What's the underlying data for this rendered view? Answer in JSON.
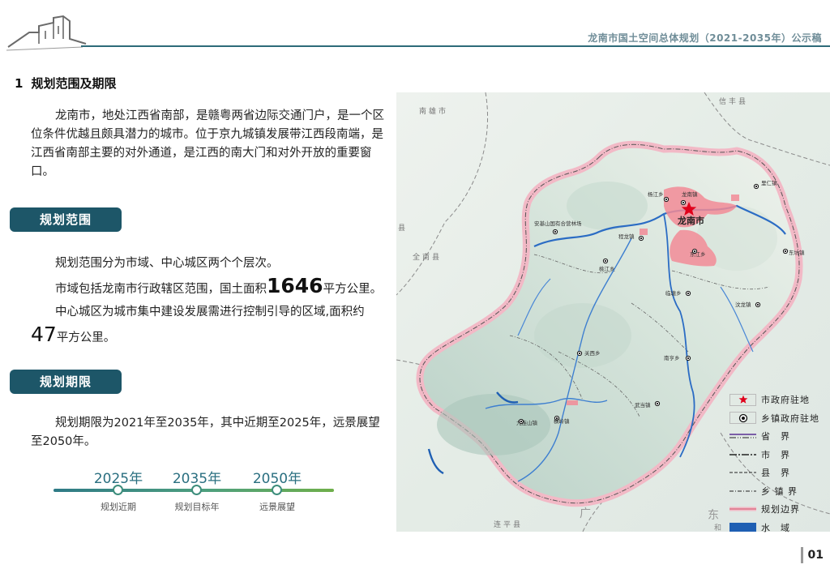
{
  "header": {
    "title": "龙南市国土空间总体规划（2021-2035年）公示稿"
  },
  "section": {
    "number": "1",
    "title": "规划范围及期限"
  },
  "intro": {
    "text": "龙南市，地处江西省南部，是赣粤两省边际交通门户，是一个区位条件优越且颇具潜力的城市。位于京九城镇发展带江西段南端，是江西省南部主要的对外通道，是江西的南大门和对外开放的重要窗口。"
  },
  "scope": {
    "heading": "规划范围",
    "line1": "规划范围分为市域、中心城区两个个层次。",
    "line2_prefix": "市域包括龙南市行政辖区范围，国土面积",
    "area_total": "1646",
    "line2_suffix": "平方公里。",
    "line3": "中心城区为城市集中建设发展需进行控制引导的区域,面积约",
    "area_center": "47",
    "line4_suffix": "平方公里。"
  },
  "period": {
    "heading": "规划期限",
    "text": "规划期限为2021年至2035年，其中近期至2025年，远景展望至2050年。"
  },
  "timeline": [
    {
      "year": "2025年",
      "label": "规划近期"
    },
    {
      "year": "2035年",
      "label": "规划目标年"
    },
    {
      "year": "2050年",
      "label": "远景展望"
    }
  ],
  "map": {
    "city_label": "龙南市",
    "outer_labels": [
      "南雄市",
      "信丰县",
      "全南县",
      "县",
      "连平县",
      "广",
      "东",
      "和"
    ],
    "towns": [
      "杨江乡",
      "龙南镇",
      "东江乡",
      "里仁镇",
      "安基山国有合营林场",
      "程龙镇",
      "东坑镇",
      "桃江乡",
      "临塘乡",
      "汶龙镇",
      "关西乡",
      "南亨乡",
      "九连山镇",
      "横岭镇",
      "武当镇"
    ]
  },
  "legend": [
    {
      "icon": "red-star",
      "label": "市政府驻地"
    },
    {
      "icon": "town-dot",
      "label": "乡镇政府驻地"
    },
    {
      "icon": "province-boundary",
      "label": "省　界"
    },
    {
      "icon": "city-boundary",
      "label": "市　界"
    },
    {
      "icon": "county-boundary",
      "label": "县　界"
    },
    {
      "icon": "township-boundary",
      "label": "乡 镇 界"
    },
    {
      "icon": "plan-boundary",
      "label": "规划边界"
    },
    {
      "icon": "water-area",
      "label": "水　域"
    }
  ],
  "colors": {
    "brand": "#1d5668",
    "timeline_start": "#2e7a86",
    "timeline_end": "#6faf4a",
    "plan_boundary": "#f2b9c6",
    "urban": "#f28b96",
    "water": "#1f5fb3"
  },
  "page_number": "01"
}
